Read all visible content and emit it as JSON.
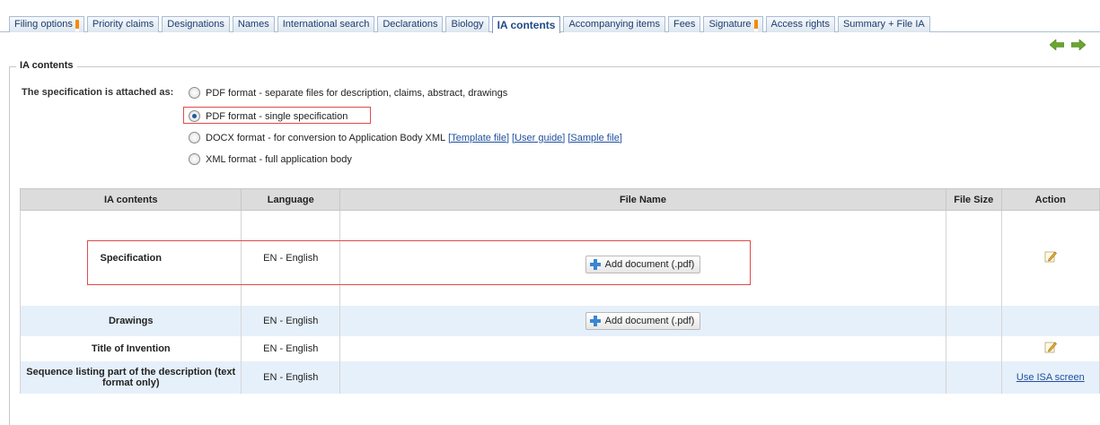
{
  "tabs": [
    {
      "label": "Filing options",
      "warning": true
    },
    {
      "label": "Priority claims"
    },
    {
      "label": "Designations"
    },
    {
      "label": "Names"
    },
    {
      "label": "International search"
    },
    {
      "label": "Declarations"
    },
    {
      "label": "Biology"
    },
    {
      "label": "IA contents",
      "active": true
    },
    {
      "label": "Accompanying items"
    },
    {
      "label": "Fees"
    },
    {
      "label": "Signature",
      "warning": true
    },
    {
      "label": "Access rights"
    },
    {
      "label": "Summary + File IA"
    }
  ],
  "section": {
    "legend": "IA contents",
    "spec_label": "The specification is attached as:",
    "options": [
      {
        "label": "PDF format - separate files for description, claims, abstract, drawings",
        "checked": false
      },
      {
        "label": "PDF format - single specification",
        "checked": true
      },
      {
        "label": "DOCX format - for conversion to Application Body XML",
        "checked": false,
        "links": [
          "[Template file]",
          "[User guide]",
          "[Sample file]"
        ]
      },
      {
        "label": "XML format - full application body",
        "checked": false
      }
    ]
  },
  "table": {
    "headers": [
      "IA contents",
      "Language",
      "File Name",
      "File Size",
      "Action"
    ],
    "rows": [
      {
        "content": "Specification",
        "language": "EN - English",
        "button": "Add document (.pdf)",
        "action": "edit-icon"
      },
      {
        "content": "Drawings",
        "language": "EN - English",
        "button": "Add document (.pdf)"
      },
      {
        "content": "Title of Invention",
        "language": "EN - English",
        "action": "edit-icon"
      },
      {
        "content": "Sequence listing part of the description (text format only)",
        "language": "EN - English",
        "action_link": "Use ISA screen"
      }
    ]
  },
  "colors": {
    "accent": "#1f4a85",
    "highlight": "#e04b4b",
    "row_blue": "#e6f0fa",
    "header_gray": "#dcdcdc",
    "arrow_green": "#6aa62f"
  }
}
